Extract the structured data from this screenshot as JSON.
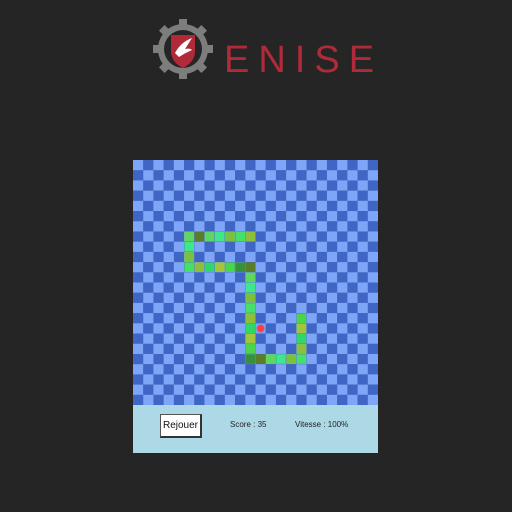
{
  "brand": {
    "name": "ENISE",
    "colors": {
      "gear": "#7d7d7d",
      "shield": "#b02a3a",
      "text": "#b02a3a"
    },
    "icon": "gear-shield-bird-logo"
  },
  "board": {
    "cols": 24,
    "rows": 24,
    "colors": {
      "light": "#7fa5f8",
      "dark": "#3f66c4",
      "snake": [
        "#5fd65f",
        "#3ee88a",
        "#7ac23c",
        "#45e06a",
        "#8fbe3a",
        "#2fd66a",
        "#a3c53a",
        "#4ad64a",
        "#3a8f3a",
        "#5a7d28"
      ],
      "food": "#ff4040"
    },
    "snake_cells": [
      [
        5,
        7
      ],
      [
        5,
        8
      ],
      [
        5,
        9
      ],
      [
        5,
        10
      ],
      [
        6,
        10
      ],
      [
        7,
        10
      ],
      [
        8,
        10
      ],
      [
        9,
        10
      ],
      [
        10,
        10
      ],
      [
        11,
        10
      ],
      [
        11,
        11
      ],
      [
        11,
        12
      ],
      [
        11,
        13
      ],
      [
        11,
        14
      ],
      [
        11,
        15
      ],
      [
        11,
        16
      ],
      [
        11,
        17
      ],
      [
        11,
        18
      ],
      [
        11,
        19
      ],
      [
        12,
        19
      ],
      [
        13,
        19
      ],
      [
        14,
        19
      ],
      [
        15,
        19
      ],
      [
        16,
        19
      ],
      [
        16,
        18
      ],
      [
        16,
        17
      ],
      [
        16,
        16
      ],
      [
        16,
        15
      ],
      [
        10,
        7
      ],
      [
        6,
        7
      ],
      [
        7,
        7
      ],
      [
        8,
        7
      ],
      [
        9,
        7
      ],
      [
        10,
        7
      ],
      [
        11,
        7
      ]
    ],
    "food_cell": [
      12,
      16
    ]
  },
  "controls": {
    "replay_label": "Rejouer",
    "score_text": "Score : 35",
    "speed_text": "Vitesse : 100%"
  }
}
